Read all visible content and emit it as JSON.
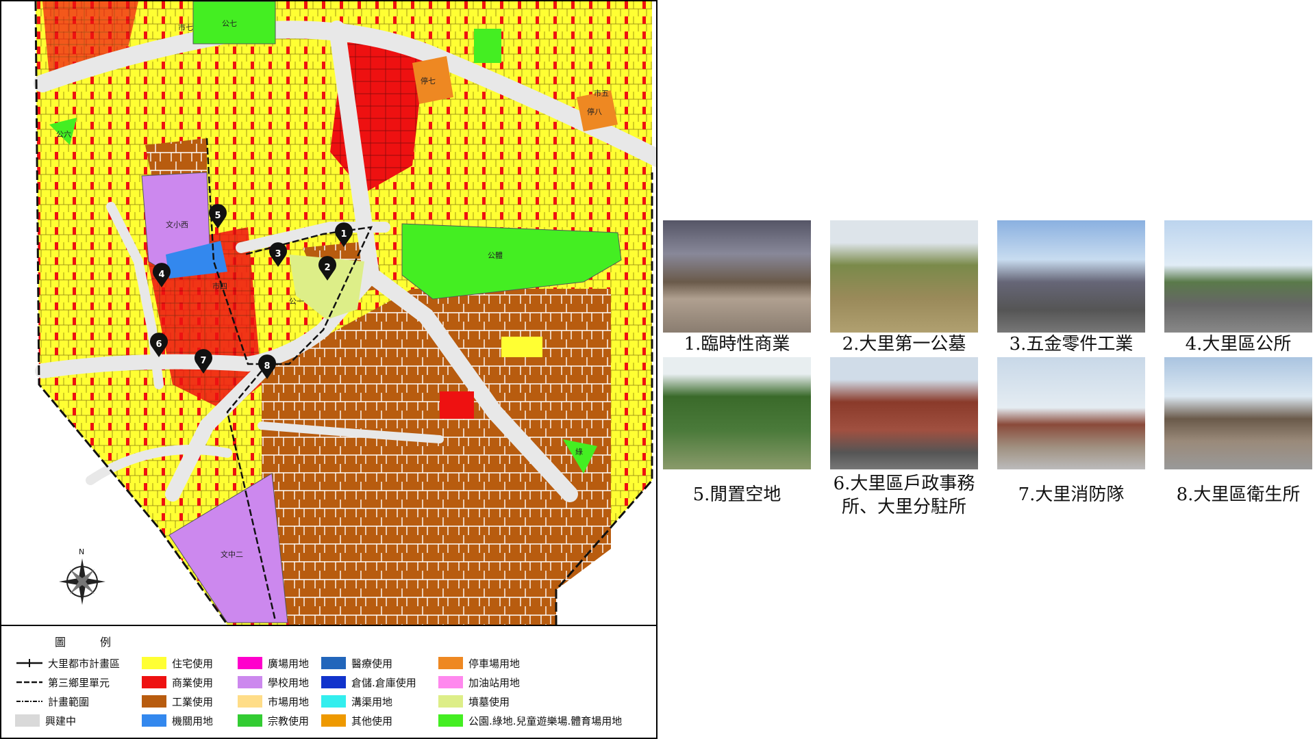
{
  "map": {
    "labels": {
      "park7": "公七",
      "market7": "市七",
      "park6": "公六",
      "parking7": "停七",
      "market5": "市五",
      "parking8": "停八",
      "school_west": "文小西",
      "sports": "公體",
      "park1": "公一",
      "market4": "市四",
      "school_mid2": "文中二",
      "green": "綠"
    },
    "markers": [
      "1",
      "2",
      "3",
      "4",
      "5",
      "6",
      "7",
      "8"
    ],
    "north": "N"
  },
  "legend": {
    "title": "圖例",
    "items": [
      {
        "label": "大里都市計畫區",
        "kind": "line-plan"
      },
      {
        "label": "第三鄉里單元",
        "kind": "line-unit"
      },
      {
        "label": "計畫範圍",
        "kind": "line-range"
      },
      {
        "label": "興建中",
        "color": "#d9d9d9"
      },
      {
        "label": "住宅使用",
        "color": "#ffff33"
      },
      {
        "label": "商業使用",
        "color": "#ee1111"
      },
      {
        "label": "工業使用",
        "color": "#b85c0f"
      },
      {
        "label": "機關用地",
        "color": "#3388ee"
      },
      {
        "label": "廣場用地",
        "color": "#ff00cc"
      },
      {
        "label": "學校用地",
        "color": "#cc88ee"
      },
      {
        "label": "市場用地",
        "color": "#ffdd88"
      },
      {
        "label": "宗教使用",
        "color": "#33cc33"
      },
      {
        "label": "醫療使用",
        "color": "#2266bb"
      },
      {
        "label": "倉儲.倉庫使用",
        "color": "#1133cc"
      },
      {
        "label": "溝渠用地",
        "color": "#33eeee"
      },
      {
        "label": "其他使用",
        "color": "#ee9900"
      },
      {
        "label": "停車場用地",
        "color": "#ee8822"
      },
      {
        "label": "加油站用地",
        "color": "#ff88ee"
      },
      {
        "label": "墳墓使用",
        "color": "#ddee88"
      },
      {
        "label": "公園.綠地.兒童遊樂場.體育場用地",
        "color": "#44ee22"
      }
    ]
  },
  "photos": [
    {
      "caption": "1.臨時性商業",
      "scene": "market"
    },
    {
      "caption": "2.大里第一公墓",
      "scene": "field"
    },
    {
      "caption": "3.五金零件工業",
      "scene": "street"
    },
    {
      "caption": "4.大里區公所",
      "scene": "street2"
    },
    {
      "caption": "5.閒置空地",
      "scene": "vacant"
    },
    {
      "caption": "6.大里區戶政事務所、大里分駐所",
      "scene": "building"
    },
    {
      "caption": "7.大里消防隊",
      "scene": "firestation"
    },
    {
      "caption": "8.大里區衛生所",
      "scene": "clinic"
    }
  ]
}
